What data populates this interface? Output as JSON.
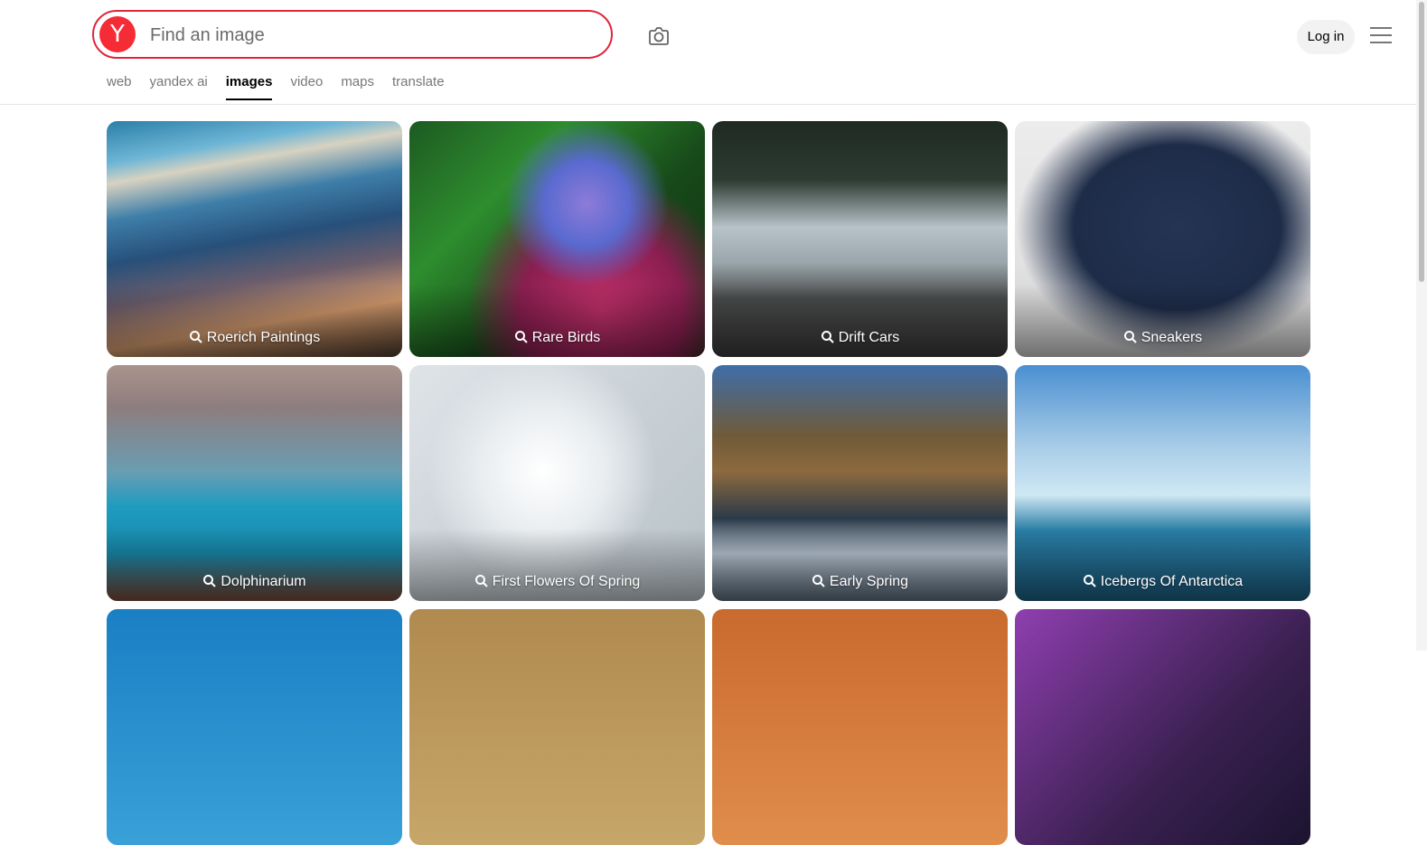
{
  "search": {
    "logo_letter": "Y",
    "placeholder": "Find an image"
  },
  "header": {
    "login_label": "Log in"
  },
  "tabs": [
    {
      "label": "web"
    },
    {
      "label": "yandex ai"
    },
    {
      "label": "images",
      "active": true
    },
    {
      "label": "video"
    },
    {
      "label": "maps"
    },
    {
      "label": "translate"
    }
  ],
  "cards": [
    {
      "label": "Roerich Paintings"
    },
    {
      "label": "Rare Birds"
    },
    {
      "label": "Drift Cars"
    },
    {
      "label": "Sneakers"
    },
    {
      "label": "Dolphinarium"
    },
    {
      "label": "First Flowers Of Spring"
    },
    {
      "label": "Early Spring"
    },
    {
      "label": "Icebergs Of Antarctica"
    }
  ],
  "colors": {
    "search_border": "#e0253a",
    "logo_background": "#f52b36",
    "login_background": "#f2f2f2"
  }
}
